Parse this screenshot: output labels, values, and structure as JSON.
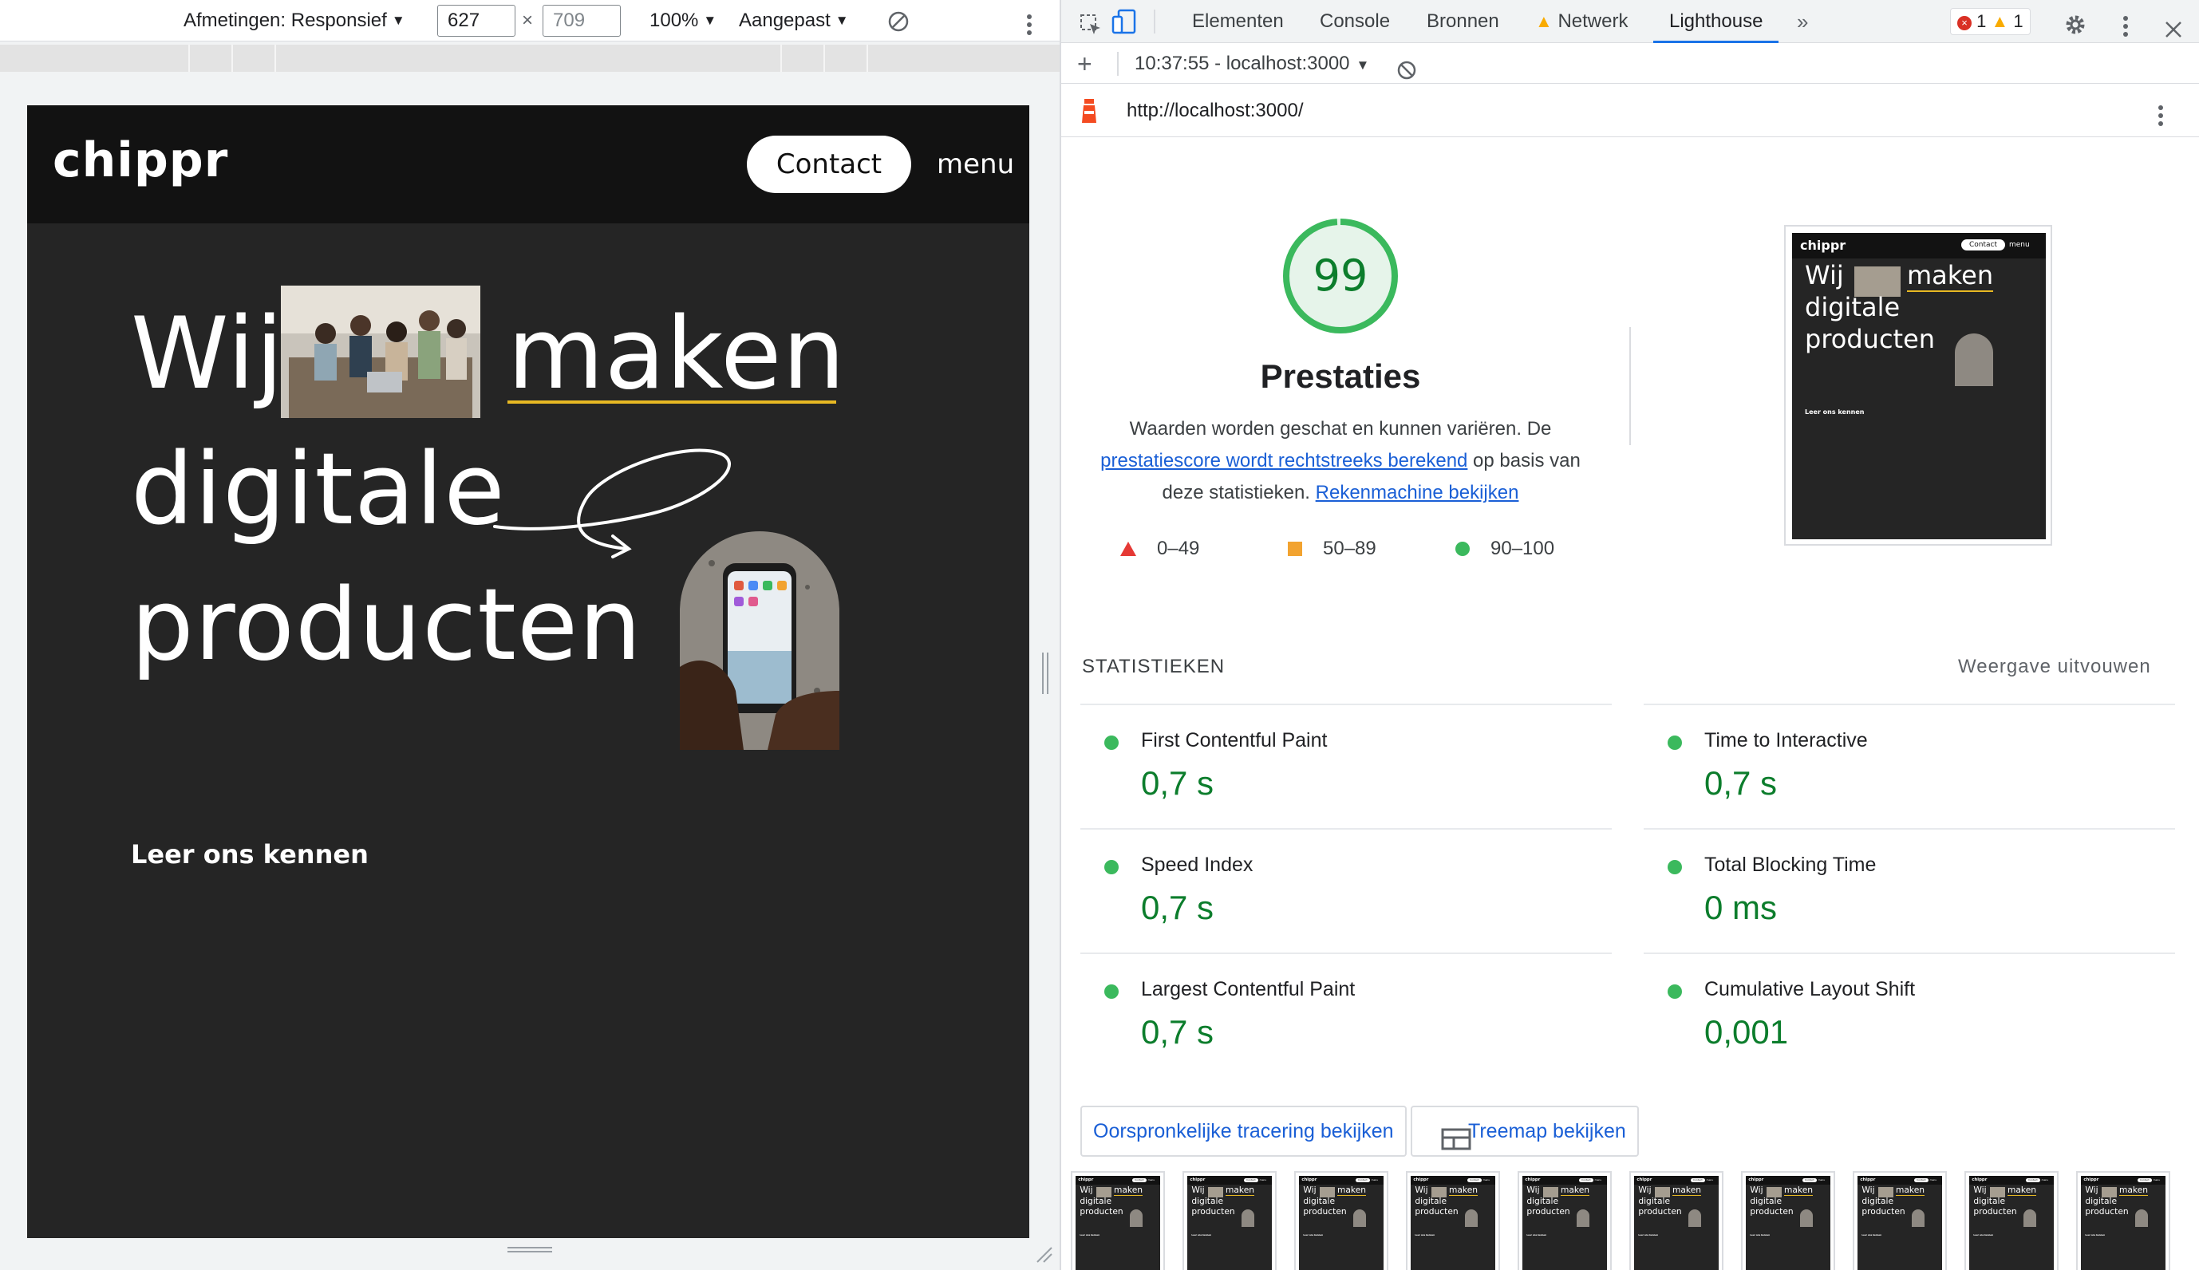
{
  "device_toolbar": {
    "dimensions_label": "Afmetingen: Responsief",
    "width_value": "627",
    "times": "×",
    "height_value": "709",
    "zoom": "100%",
    "throttle": "Aangepast"
  },
  "site": {
    "logo": "chippr",
    "contact": "Contact",
    "menu": "menu",
    "hero": {
      "w1": "Wij",
      "w2": "maken",
      "w3": "digitale",
      "w4": "producten"
    },
    "learn_more": "Leer ons kennen"
  },
  "devtools": {
    "tabs": [
      "Elementen",
      "Console",
      "Bronnen",
      "Netwerk",
      "Lighthouse"
    ],
    "errors": "1",
    "warnings": "1",
    "report_time": "10:37:55 - localhost:3000",
    "url": "http://localhost:3000/"
  },
  "lighthouse": {
    "score": 99,
    "score_text": "99",
    "category": "Prestaties",
    "desc_1": "Waarden worden geschat en kunnen variëren. De",
    "desc_link1": "prestatiescore wordt rechtstreeks berekend",
    "desc_2": " op basis van deze statistieken.",
    "desc_link2": "Rekenmachine bekijken",
    "legend": [
      "0–49",
      "50–89",
      "90–100"
    ],
    "colors": {
      "pass": "#0c7d2c",
      "pass_fill": "#3bb95d",
      "average": "#f2a330",
      "fail": "#e53935"
    },
    "stats_heading": "STATISTIEKEN",
    "expand": "Weergave uitvouwen",
    "metrics": [
      {
        "name": "First Contentful Paint",
        "value": "0,7 s"
      },
      {
        "name": "Time to Interactive",
        "value": "0,7 s"
      },
      {
        "name": "Speed Index",
        "value": "0,7 s"
      },
      {
        "name": "Total Blocking Time",
        "value": "0 ms"
      },
      {
        "name": "Largest Contentful Paint",
        "value": "0,7 s"
      },
      {
        "name": "Cumulative Layout Shift",
        "value": "0,001"
      }
    ],
    "btn_trace": "Oorspronkelijke tracering bekijken",
    "btn_treemap": "Treemap bekijken",
    "thumb_count": 10
  },
  "thumb": {
    "logo": "chippr",
    "contact": "Contact",
    "menu": "menu",
    "w1": "Wij",
    "w2": "maken",
    "w3": "digitale",
    "w4": "producten",
    "learn": "Leer ons kennen"
  }
}
